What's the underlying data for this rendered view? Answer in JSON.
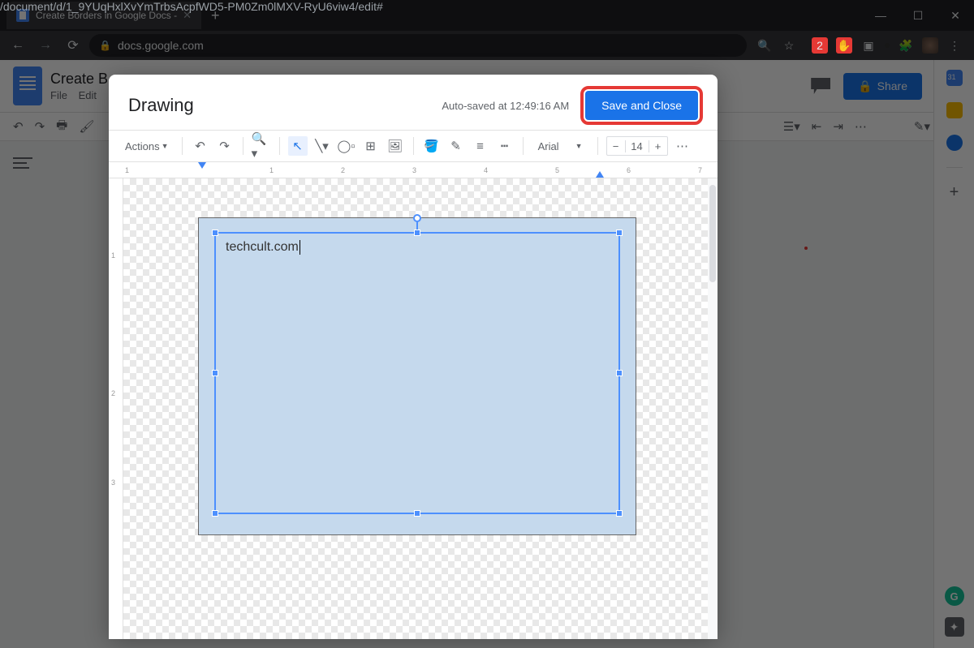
{
  "browser": {
    "tab_title": "Create Borders in Google Docs -",
    "url_host": "docs.google.com",
    "url_path": "/document/d/1_9YUqHxlXvYmTrbsAcpfWD5-PM0Zm0lMXV-RyU6viw4/edit#",
    "ext_badge": "2"
  },
  "docs": {
    "title": "Create B",
    "menus": {
      "file": "File",
      "edit": "Edit"
    },
    "share": "Share"
  },
  "drawing": {
    "title": "Drawing",
    "autosave": "Auto-saved at 12:49:16 AM",
    "save_close": "Save and Close",
    "actions": "Actions",
    "font": "Arial",
    "font_size": "14",
    "textbox_content": "techcult.com",
    "ruler_labels": [
      "1",
      "1",
      "2",
      "3",
      "4",
      "5",
      "6",
      "7"
    ],
    "vruler_labels": [
      "1",
      "2",
      "3"
    ]
  }
}
